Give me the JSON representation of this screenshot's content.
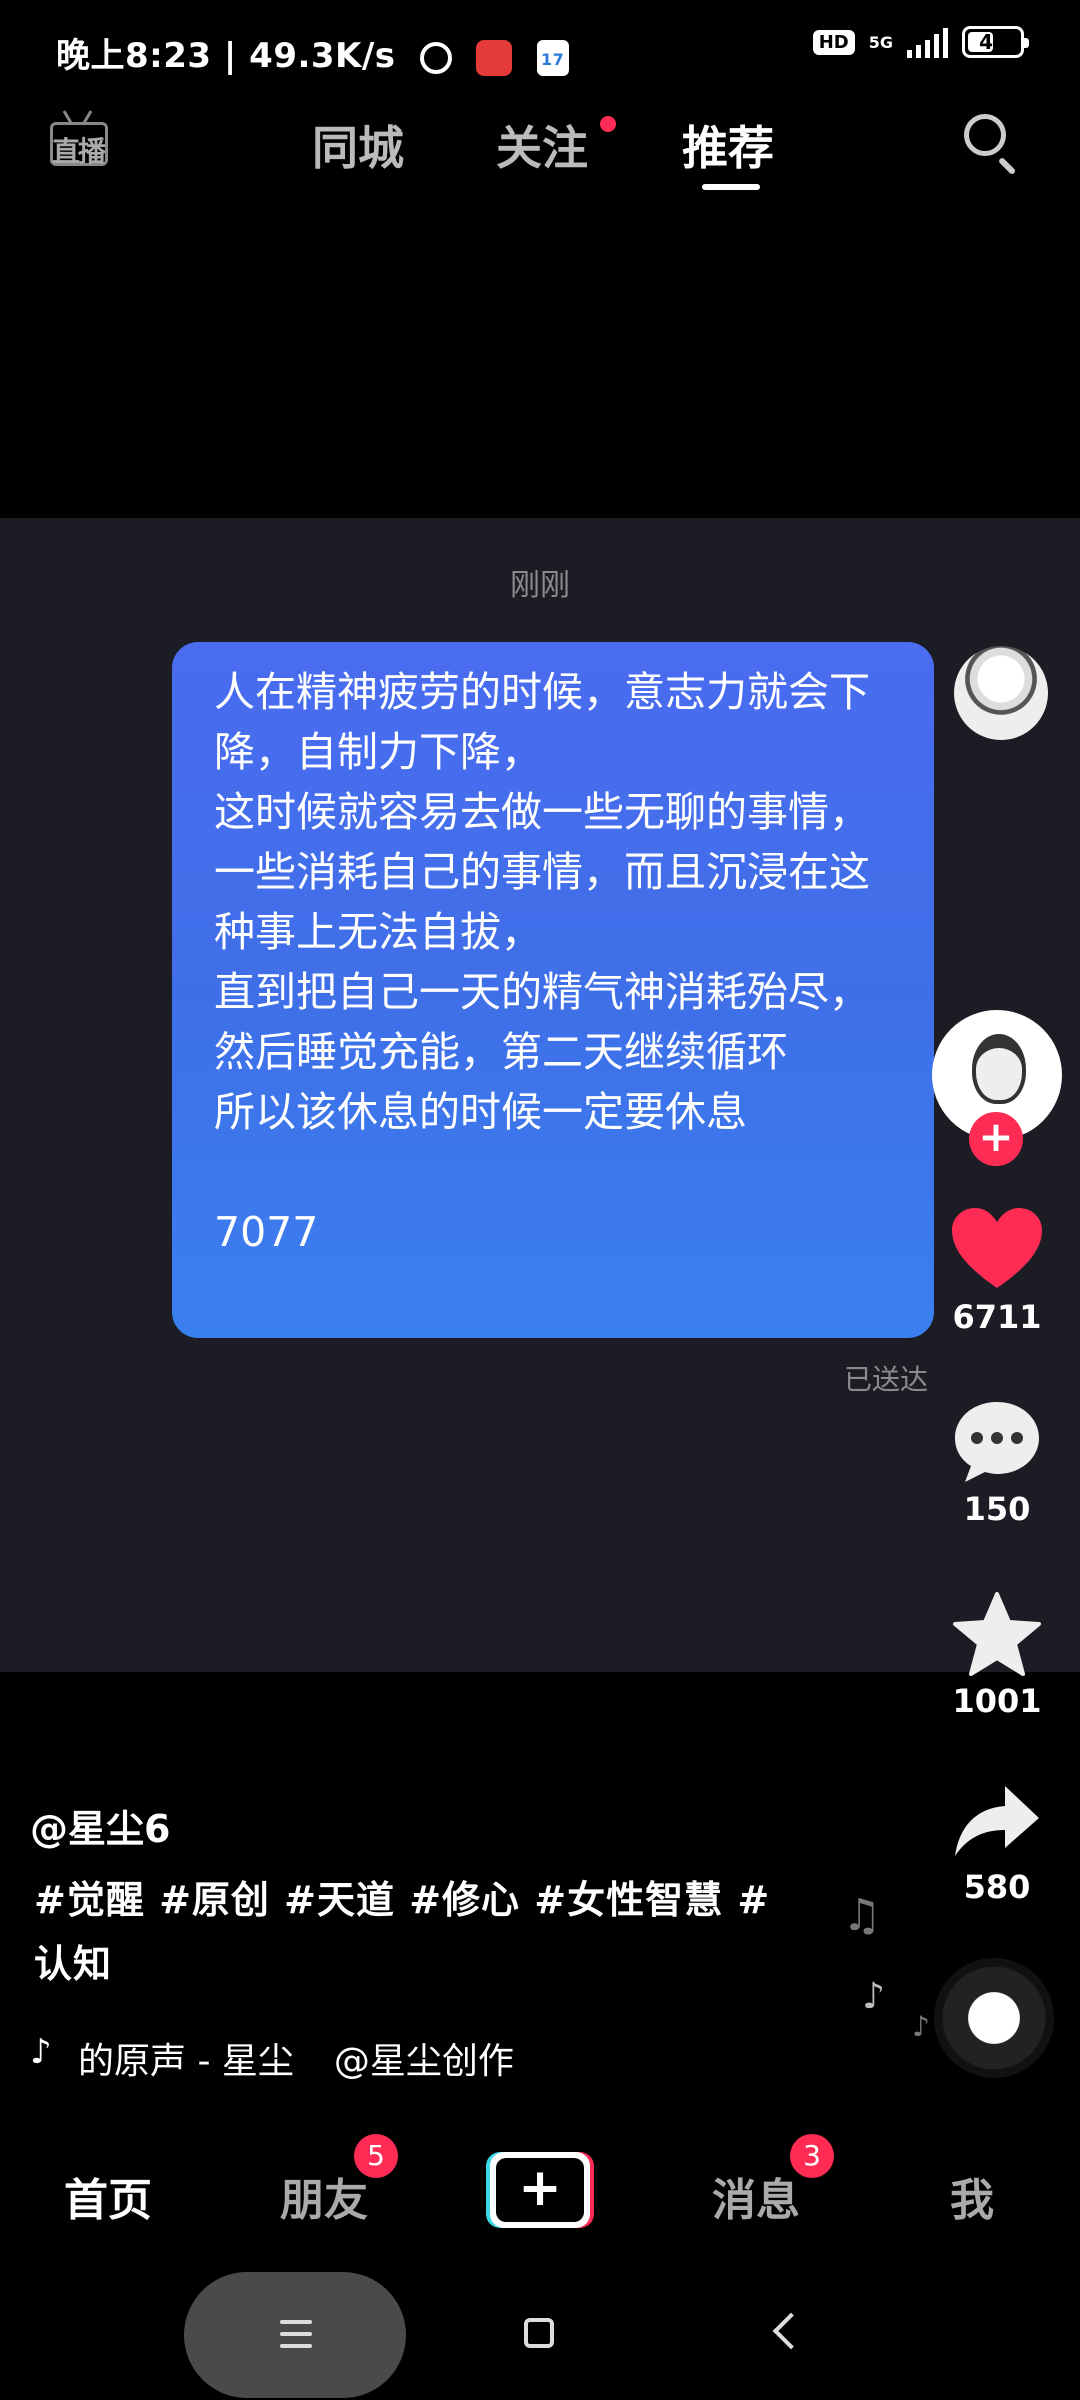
{
  "status_bar": {
    "left_text": "晚上8:23 | 49.3K/s",
    "calendar_day": "17",
    "hd": "HD",
    "network": "5G",
    "battery": "44",
    "battery_level": 0.44
  },
  "top_nav": {
    "live_label": "直播",
    "tabs": [
      "同城",
      "关注",
      "推荐"
    ],
    "active_tab": "推荐",
    "has_follow_dot": true
  },
  "chat": {
    "time": "刚刚",
    "message": "人在精神疲劳的时候，意志力就会下降，自制力下降，\n这时候就容易去做一些无聊的事情，一些消耗自己的事情，而且沉浸在这种事上无法自拔，\n直到把自己一天的精气神消耗殆尽，然后睡觉充能，第二天继续循环\n所以该休息的时候一定要休息\n\n7077",
    "status": "已送达"
  },
  "actions": {
    "likes": "6711",
    "comments": "150",
    "favorites": "1001",
    "shares": "580",
    "follow_plus": "+"
  },
  "post": {
    "author": "@星尘6",
    "caption": "#觉醒 #原创 #天道 #修心 #女性智慧 #认知",
    "music_icon": "♪",
    "music": "的原声 - 星尘",
    "music_credit": "@星尘创作"
  },
  "bottom_nav": {
    "home": "首页",
    "friends": "朋友",
    "friends_badge": "5",
    "create": "+",
    "messages": "消息",
    "messages_badge": "3",
    "me": "我"
  },
  "colors": {
    "accent": "#fe2c55",
    "bubble": "#3f6fe8",
    "chat_bg": "#1c1d24"
  },
  "icons": [
    "live-icon",
    "search-icon",
    "heart-icon",
    "comment-icon",
    "star-icon",
    "share-icon",
    "music-note-icon",
    "tiktok-icon",
    "create-icon",
    "menu-icon",
    "home-icon",
    "back-icon"
  ]
}
